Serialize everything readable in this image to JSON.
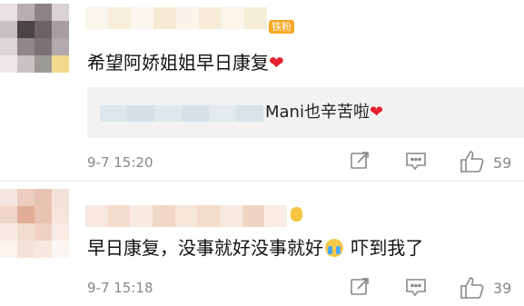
{
  "comments": [
    {
      "badge": "铁粉",
      "text": "希望阿娇姐姐早日康复",
      "heart": "❤",
      "reply": {
        "text": "Mani也辛苦啦",
        "heart": "❤"
      },
      "timestamp": "9-7 15:20",
      "likes": "59"
    },
    {
      "text_a": "早日康复，没事就好没事就好",
      "text_b": " 吓到我了",
      "timestamp": "9-7 15:18",
      "likes": "39"
    }
  ],
  "icons": {
    "share": "share-icon",
    "comment": "comment-icon",
    "like": "thumbs-up-icon"
  },
  "colors": {
    "heart": "#e5202e",
    "badge": "#f6a623",
    "meta_text": "#888888",
    "reply_bg": "#f2f2f2"
  }
}
